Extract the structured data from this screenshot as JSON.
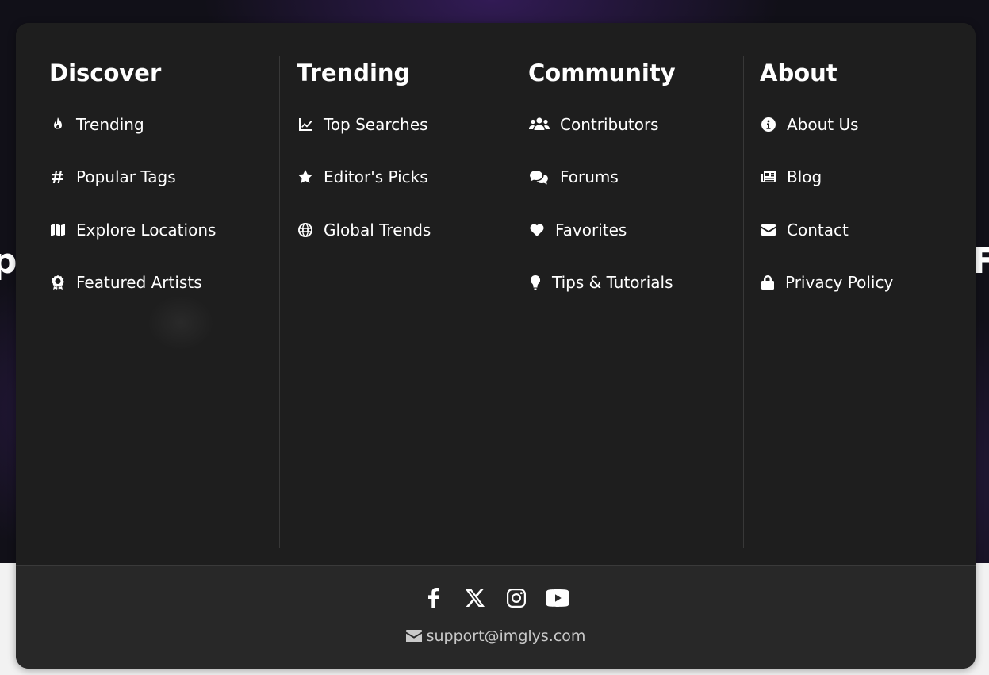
{
  "background": {
    "peek_left": "p|",
    "peek_right": "F"
  },
  "columns": [
    {
      "title": "Discover",
      "items": [
        {
          "label": "Trending",
          "icon": "fire-icon"
        },
        {
          "label": "Popular Tags",
          "icon": "hashtag-icon"
        },
        {
          "label": "Explore Locations",
          "icon": "map-icon"
        },
        {
          "label": "Featured Artists",
          "icon": "award-icon"
        }
      ]
    },
    {
      "title": "Trending",
      "items": [
        {
          "label": "Top Searches",
          "icon": "line-chart-icon"
        },
        {
          "label": "Editor's Picks",
          "icon": "star-icon"
        },
        {
          "label": "Global Trends",
          "icon": "globe-icon"
        }
      ]
    },
    {
      "title": "Community",
      "items": [
        {
          "label": "Contributors",
          "icon": "users-icon"
        },
        {
          "label": "Forums",
          "icon": "comments-icon"
        },
        {
          "label": "Favorites",
          "icon": "heart-icon"
        },
        {
          "label": "Tips & Tutorials",
          "icon": "lightbulb-icon"
        }
      ]
    },
    {
      "title": "About",
      "items": [
        {
          "label": "About Us",
          "icon": "info-circle-icon"
        },
        {
          "label": "Blog",
          "icon": "newspaper-icon"
        },
        {
          "label": "Contact",
          "icon": "envelope-icon"
        },
        {
          "label": "Privacy Policy",
          "icon": "lock-icon"
        }
      ]
    }
  ],
  "footer": {
    "socials": [
      "facebook-icon",
      "x-icon",
      "instagram-icon",
      "youtube-icon"
    ],
    "email": "support@imglys.com"
  },
  "colors": {
    "panel": "#1e1e1e",
    "footer": "#282828",
    "text": "#ffffff",
    "muted": "#c9c9c9"
  }
}
